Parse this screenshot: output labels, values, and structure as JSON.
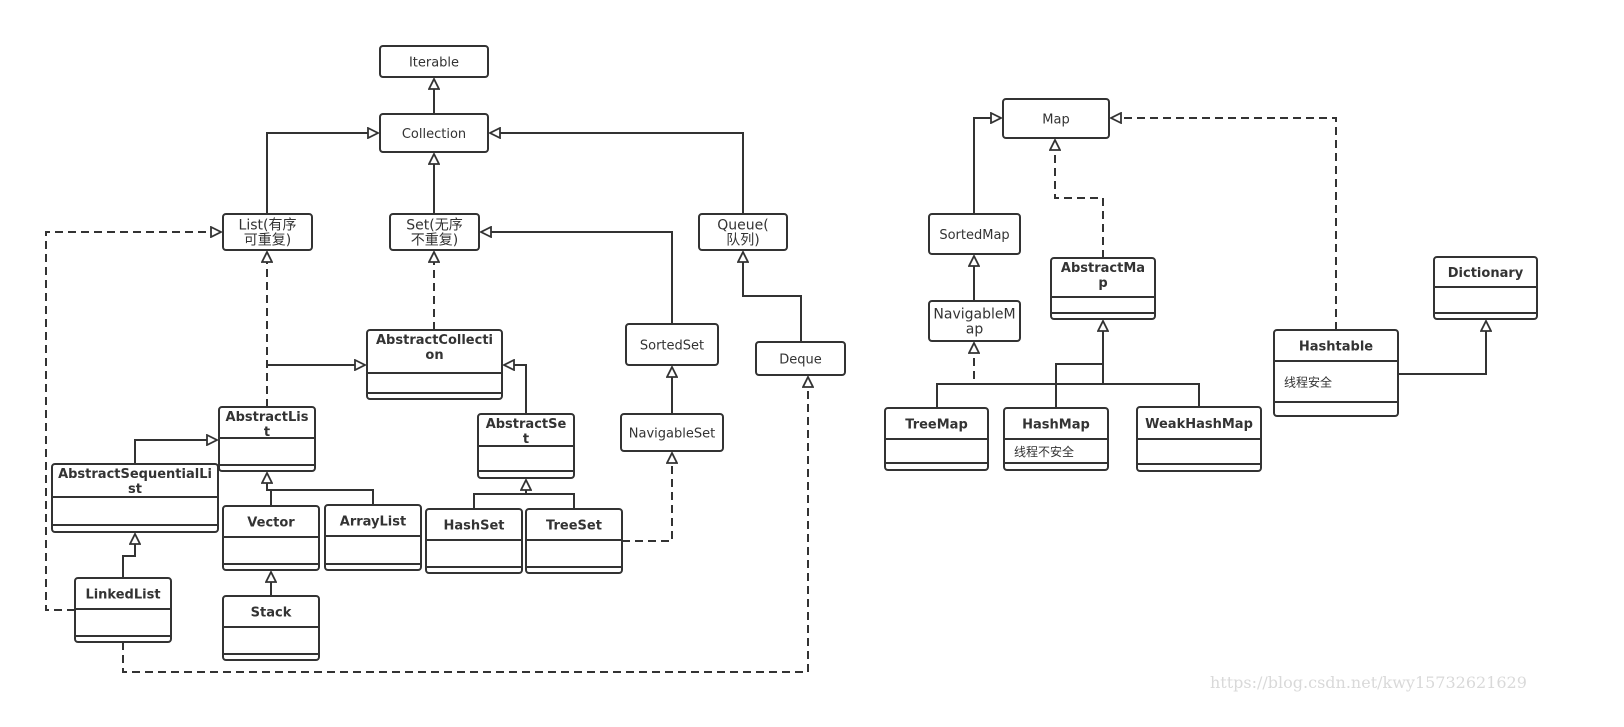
{
  "diagram": {
    "interfaces": {
      "iterable": [
        "Iterable"
      ],
      "collection": [
        "Collection"
      ],
      "list": [
        "List(有序",
        "可重复)"
      ],
      "set": [
        "Set(无序",
        "不重复)"
      ],
      "queue": [
        "Queue(",
        "队列)"
      ],
      "sortedset": [
        "SortedSet"
      ],
      "navigableset": [
        "NavigableSet"
      ],
      "deque": [
        "Deque"
      ],
      "map": [
        "Map"
      ],
      "sortedmap": [
        "SortedMap"
      ],
      "navigablemap": [
        "NavigableM",
        "ap"
      ]
    },
    "classes": {
      "abstractcollection": {
        "title": [
          "AbstractCollecti",
          "on"
        ],
        "note": ""
      },
      "abstractlist": {
        "title": [
          "AbstractLis",
          "t"
        ],
        "note": ""
      },
      "abstractset": {
        "title": [
          "AbstractSe",
          "t"
        ],
        "note": ""
      },
      "abstractsequentiallist": {
        "title": [
          "AbstractSequentialLi",
          "st"
        ],
        "note": ""
      },
      "vector": {
        "title": [
          "Vector"
        ],
        "note": ""
      },
      "arraylist": {
        "title": [
          "ArrayList"
        ],
        "note": ""
      },
      "hashset": {
        "title": [
          "HashSet"
        ],
        "note": ""
      },
      "treeset": {
        "title": [
          "TreeSet"
        ],
        "note": ""
      },
      "linkedlist": {
        "title": [
          "LinkedList"
        ],
        "note": ""
      },
      "stack": {
        "title": [
          "Stack"
        ],
        "note": ""
      },
      "treemap": {
        "title": [
          "TreeMap"
        ],
        "note": ""
      },
      "hashmap": {
        "title": [
          "HashMap"
        ],
        "note": "线程不安全"
      },
      "weakhashmap": {
        "title": [
          "WeakHashMap"
        ],
        "note": ""
      },
      "abstractmap": {
        "title": [
          "AbstractMa",
          "p"
        ],
        "note": ""
      },
      "hashtable": {
        "title": [
          "Hashtable"
        ],
        "note": "线程安全"
      },
      "dictionary": {
        "title": [
          "Dictionary"
        ],
        "note": ""
      }
    }
  },
  "watermark": "https://blog.csdn.net/kwy15732621629"
}
